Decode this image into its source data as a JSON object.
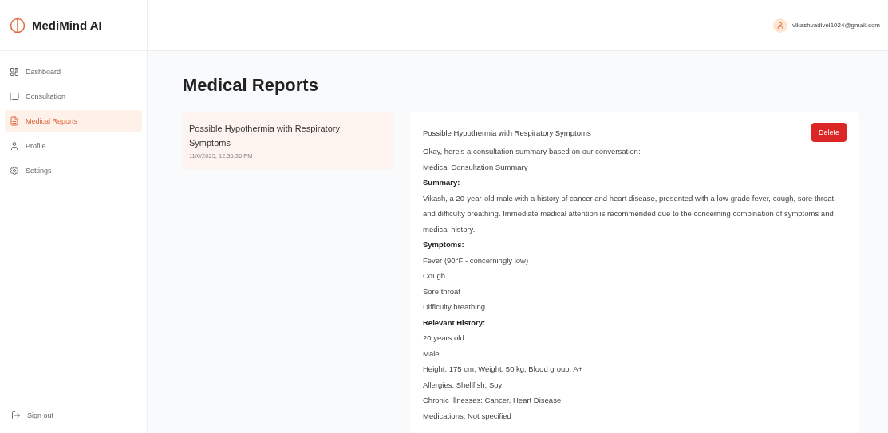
{
  "brand": {
    "name": "MediMind AI"
  },
  "user": {
    "email": "vikashvadivel1024@gmail.com"
  },
  "sidebar": {
    "items": [
      {
        "label": "Dashboard",
        "selected": false
      },
      {
        "label": "Consultation",
        "selected": false
      },
      {
        "label": "Medical Reports",
        "selected": true
      },
      {
        "label": "Profile",
        "selected": false
      },
      {
        "label": "Settings",
        "selected": false
      }
    ],
    "sign_out": "Sign out"
  },
  "page": {
    "title": "Medical Reports"
  },
  "reports": [
    {
      "title": "Possible Hypothermia with Respiratory Symptoms",
      "date": "11/6/2025, 12:36:36 PM",
      "selected": true
    }
  ],
  "detail": {
    "title": "Possible Hypothermia with Respiratory Symptoms",
    "delete_label": "Delete",
    "lines": [
      {
        "kind": "text",
        "text": "Okay, here's a consultation summary based on our conversation:"
      },
      {
        "kind": "text",
        "text": "Medical Consultation Summary"
      },
      {
        "kind": "heading",
        "text": "Summary:"
      },
      {
        "kind": "text",
        "text": "Vikash, a 20-year-old male with a history of cancer and heart disease, presented with a low-grade fever, cough, sore throat, and difficulty breathing. Immediate medical attention is recommended due to the concerning combination of symptoms and medical history."
      },
      {
        "kind": "heading",
        "text": "Symptoms:"
      },
      {
        "kind": "text",
        "text": "Fever (90°F - concerningly low)"
      },
      {
        "kind": "text",
        "text": "Cough"
      },
      {
        "kind": "text",
        "text": "Sore throat"
      },
      {
        "kind": "text",
        "text": "Difficulty breathing"
      },
      {
        "kind": "heading",
        "text": "Relevant History:"
      },
      {
        "kind": "text",
        "text": "20 years old"
      },
      {
        "kind": "text",
        "text": "Male"
      },
      {
        "kind": "text",
        "text": "Height: 175 cm, Weight: 50 kg, Blood group: A+"
      },
      {
        "kind": "text",
        "text": "Allergies: Shellfish; Soy"
      },
      {
        "kind": "text",
        "text": "Chronic Illnesses: Cancer, Heart Disease"
      },
      {
        "kind": "text",
        "text": "Medications: Not specified"
      }
    ]
  }
}
